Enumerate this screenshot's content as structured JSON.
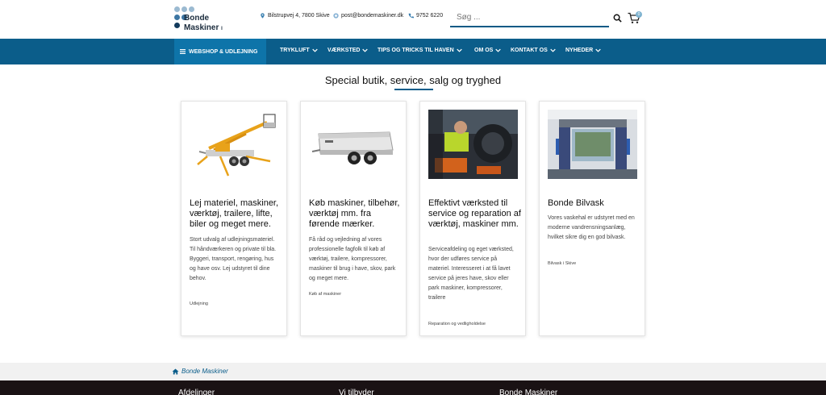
{
  "header": {
    "logo": {
      "line1": "Bonde",
      "line2": "Maskiner",
      "mark": "I"
    },
    "contacts": [
      {
        "icon": "location-pin-icon",
        "text": "Bilstrupvej 4, 7800 Skive"
      },
      {
        "icon": "email-icon",
        "text": "post@bondemaskiner.dk"
      },
      {
        "icon": "phone-icon",
        "text": "9752 6220"
      }
    ],
    "search": {
      "placeholder": "Søg ..."
    },
    "cart": {
      "count": "0"
    }
  },
  "nav": {
    "webshop_label": "WEBSHOP & UDLEJNING",
    "items": [
      {
        "label": "TRYKLUFT"
      },
      {
        "label": "VÆRKSTED"
      },
      {
        "label": "TIPS OG TRICKS TIL HAVEN"
      },
      {
        "label": "OM OS"
      },
      {
        "label": "KONTAKT OS"
      },
      {
        "label": "NYHEDER"
      }
    ]
  },
  "main": {
    "title": "Special butik, service, salg og tryghed",
    "cards": [
      {
        "image": "lift-trailer-photo",
        "title": "Lej materiel, maskiner, værktøj, trailere, lifte, biler og meget mere.",
        "description": "Stort udvalg af udlejningsmateriel. Til håndværkeren og private til bla. Byggeri, transport, rengøring, hus og have osv. Lej udstyret til dine behov.",
        "link": "Udlejning"
      },
      {
        "image": "trailer-photo",
        "title": "Køb maskiner, tilbehør, værktøj mm. fra førende mærker.",
        "description": "Få råd og vejledning af vores professionelle fagfolk til køb af værktøj, trailere, kompressorer, maskiner til brug i have, skov, park og meget mere.",
        "link": "Køb af maskiner"
      },
      {
        "image": "workshop-photo",
        "title": "Effektivt værksted til service og reparation af værktøj, maskiner mm.",
        "description": "Serviceafdeling og eget værksted, hvor der udføres service på materiel. Interesseret i at få lavet service på jeres have, skov eller park maskiner, kompressorer, trailere",
        "link": "Reparation og vedligholdelse"
      },
      {
        "image": "car-wash-photo",
        "title": "Bonde Bilvask",
        "description": "Vores vaskehal er udstyret med en moderne vandrensningsanlæg, hvilket sikre dig en god bilvask.",
        "link": "Bilvask i Skive"
      }
    ]
  },
  "breadcrumb": {
    "home_label": "Bonde Maskiner"
  },
  "footer": {
    "headings": [
      "Afdelinger",
      "Vi tilbyder",
      "Bonde Maskiner"
    ]
  },
  "colors": {
    "nav_bg": "#0b5d8a",
    "nav_active_bg": "#0e74a9",
    "footer_bg": "#1a1214"
  }
}
